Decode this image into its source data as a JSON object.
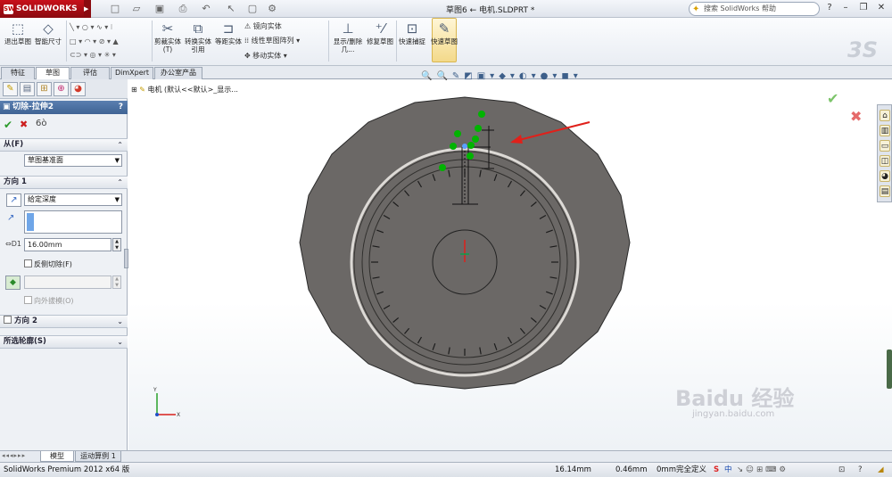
{
  "app": {
    "brand": "SOLIDWORKS",
    "document_title": "草图6 ← 电机.SLDPRT *"
  },
  "help_search": {
    "placeholder": "搜索 SolidWorks 帮助"
  },
  "ribbon": {
    "exit_sketch": "退出草图",
    "smart_dim": "智能尺寸",
    "trim": "剪裁实体(T)",
    "convert": "转换实体引用",
    "offset": "等距实体",
    "mirror": "镜向实体",
    "linear_pattern": "线性草图阵列",
    "move": "移动实体",
    "show_hide": "显示/删除几...",
    "repair": "修复草图",
    "snap": "快速捕捉",
    "quick_sketch": "快速草图"
  },
  "tabs": [
    "特征",
    "草图",
    "评估",
    "DimXpert",
    "办公室产品"
  ],
  "active_tab": 1,
  "feature": {
    "title": "切除-拉伸2",
    "help": "?",
    "from_label": "从(F)",
    "from_value": "草图基准面",
    "dir1_label": "方向 1",
    "end_condition": "给定深度",
    "depth": "16.00mm",
    "flip_side": "反侧切除(F)",
    "draft_outward": "向外拔模(O)",
    "dir2_label": "方向 2",
    "contours_label": "所选轮廓(S)"
  },
  "tree": {
    "root": "电机 (默认<<默认>_显示..."
  },
  "bottom_tabs": [
    "模型",
    "运动算例 1"
  ],
  "status": {
    "product": "SolidWorks Premium 2012 x64 版",
    "x": "16.14mm",
    "y": "0.46mm",
    "z": "0mm",
    "state": "完全定义"
  },
  "colors": {
    "accent": "#3f6394",
    "arrow": "#e0201a",
    "body": "#6b6866",
    "relation": "#00b400"
  }
}
